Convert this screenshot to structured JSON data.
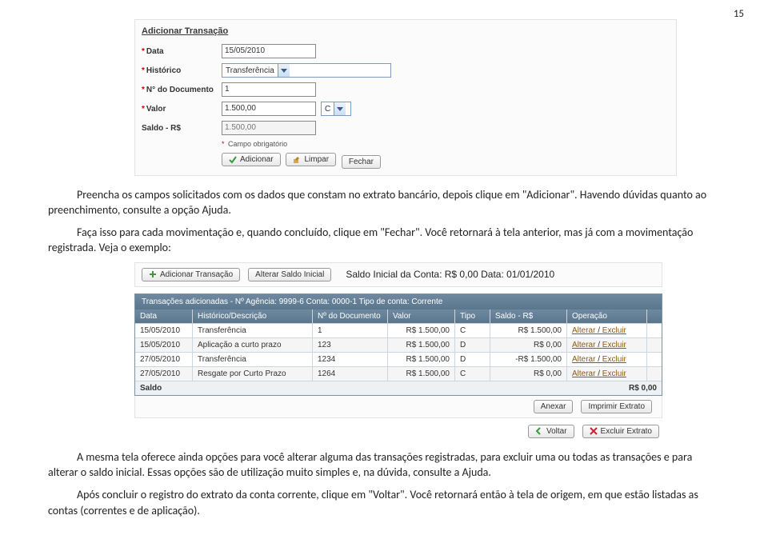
{
  "page_number": "15",
  "screenshot1": {
    "header": "Adicionar Transação",
    "label_data": "Data",
    "value_data": "15/05/2010",
    "label_historico": "Histórico",
    "value_historico": "Transferência",
    "label_numdoc": "N° do Documento",
    "value_numdoc": "1",
    "label_valor": "Valor",
    "value_valor": "1.500,00",
    "select_c": "C",
    "label_saldo": "Saldo - R$",
    "value_saldo": "1.500,00",
    "note": "Campo obrigatório",
    "btn_adicionar": "Adicionar",
    "btn_limpar": "Limpar",
    "btn_fechar": "Fechar"
  },
  "para1": "Preencha os campos solicitados com os dados que constam no extrato bancário, depois clique em \"Adicionar\". Havendo dúvidas quanto ao preenchimento, consulte a opção Ajuda.",
  "para2": "Faça isso para cada movimentação e, quando concluído, clique em \"Fechar\". Você retornará à tela anterior, mas já com a movimentação registrada. Veja o exemplo:",
  "screenshot2": {
    "btn_add": "Adicionar Transação",
    "btn_alter": "Alterar Saldo Inicial",
    "title": "Saldo Inicial da Conta: R$ 0,00 Data: 01/01/2010",
    "caption": "Transações adicionadas - Nº Agência: 9999-6 Conta: 0000-1 Tipo de conta: Corrente",
    "cols": {
      "data": "Data",
      "hist": "Histórico/Descrição",
      "doc": "Nº do Documento",
      "valor": "Valor",
      "tipo": "Tipo",
      "saldo": "Saldo - R$",
      "op": "Operação"
    },
    "rows": [
      {
        "data": "15/05/2010",
        "hist": "Transferência",
        "doc": "1",
        "valor": "R$ 1.500,00",
        "tipo": "C",
        "saldo": "R$ 1.500,00",
        "alterar": "Alterar",
        "excluir": "Excluir"
      },
      {
        "data": "15/05/2010",
        "hist": "Aplicação a curto prazo",
        "doc": "123",
        "valor": "R$ 1.500,00",
        "tipo": "D",
        "saldo": "R$ 0,00",
        "alterar": "Alterar",
        "excluir": "Excluir"
      },
      {
        "data": "27/05/2010",
        "hist": "Transferência",
        "doc": "1234",
        "valor": "R$ 1.500,00",
        "tipo": "D",
        "saldo": "-R$ 1.500,00",
        "alterar": "Alterar",
        "excluir": "Excluir"
      },
      {
        "data": "27/05/2010",
        "hist": "Resgate por Curto Prazo",
        "doc": "1264",
        "valor": "R$ 1.500,00",
        "tipo": "C",
        "saldo": "R$ 0,00",
        "alterar": "Alterar",
        "excluir": "Excluir"
      }
    ],
    "foot_label": "Saldo",
    "foot_value": "R$ 0,00",
    "btn_anexar": "Anexar",
    "btn_imprimir": "Imprimir Extrato",
    "btn_voltar": "Voltar",
    "btn_excluir_extrato": "Excluir Extrato"
  },
  "para3": "A mesma tela oferece ainda opções para você alterar alguma das transações registradas, para excluir uma ou todas as transações e para alterar o saldo inicial. Essas opções são de utilização muito simples e, na dúvida, consulte a Ajuda.",
  "para4": "Após concluir o registro do extrato da conta corrente, clique em \"Voltar\". Você retornará então à tela de origem, em que estão listadas as contas (correntes e de aplicação)."
}
